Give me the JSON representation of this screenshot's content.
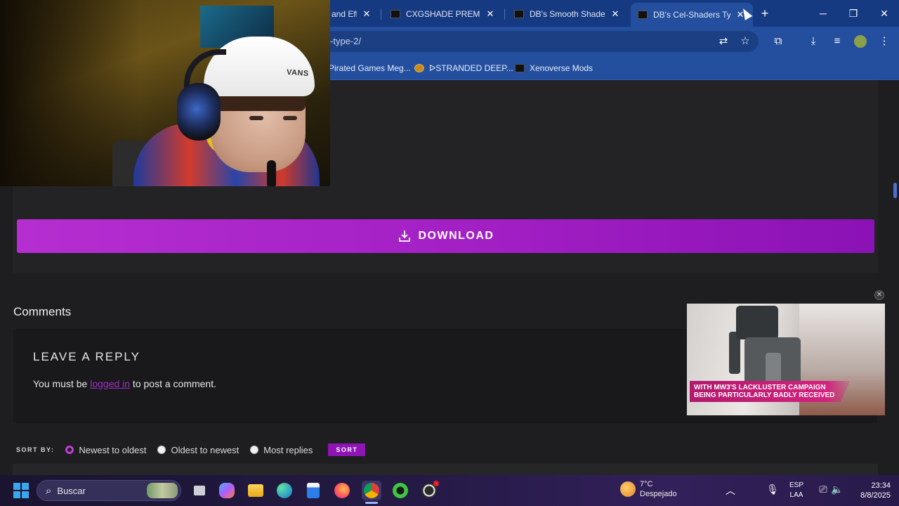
{
  "browser": {
    "tabs": [
      {
        "label": "and Effe",
        "favicon": "site-logo-icon"
      },
      {
        "label": "CXGSHADE PREMIUM",
        "favicon": "site-logo-icon"
      },
      {
        "label": "DB's Smooth Shaders",
        "favicon": "site-logo-icon"
      },
      {
        "label": "DB's Cel-Shaders Type",
        "favicon": "site-logo-icon",
        "active": true
      }
    ],
    "address": "-type-2/",
    "bookmarks": [
      {
        "label": "Pirated Games Meg..."
      },
      {
        "label": "ᐅSTRANDED DEEP..."
      },
      {
        "label": "Xenoverse Mods"
      }
    ],
    "controls": {
      "new_tab": "+",
      "minimize": "─",
      "maximize": "❐",
      "close": "✕"
    }
  },
  "page": {
    "download_label": "DOWNLOAD",
    "comments_title": "Comments",
    "reply_title": "LEAVE A REPLY",
    "reply_text_before": "You must be ",
    "reply_link": "logged in",
    "reply_text_after": " to post a comment.",
    "sort": {
      "label": "SORT BY:",
      "options": [
        {
          "label": "Newest to oldest",
          "checked": true
        },
        {
          "label": "Oldest to newest",
          "checked": false
        },
        {
          "label": "Most replies",
          "checked": false
        }
      ],
      "button": "SORT"
    }
  },
  "webcam": {
    "cap_logo": "VANS"
  },
  "ad": {
    "caption_line1": "WITH MW3'S LACKLUSTER CAMPAIGN",
    "caption_line2": "BEING PARTICULARLY BADLY RECEIVED",
    "close": "✕"
  },
  "taskbar": {
    "search_label": "Buscar",
    "weather_temp": "7°C",
    "weather_desc": "Despejado",
    "lang_top": "ESP",
    "lang_bottom": "LAA",
    "time": "23:34",
    "date": "8/8/2025",
    "tray_chevron": "︿"
  },
  "colors": {
    "accent_purple": "#a21fc4",
    "browser_blue": "#234f9e",
    "page_bg": "#1e1e20"
  }
}
